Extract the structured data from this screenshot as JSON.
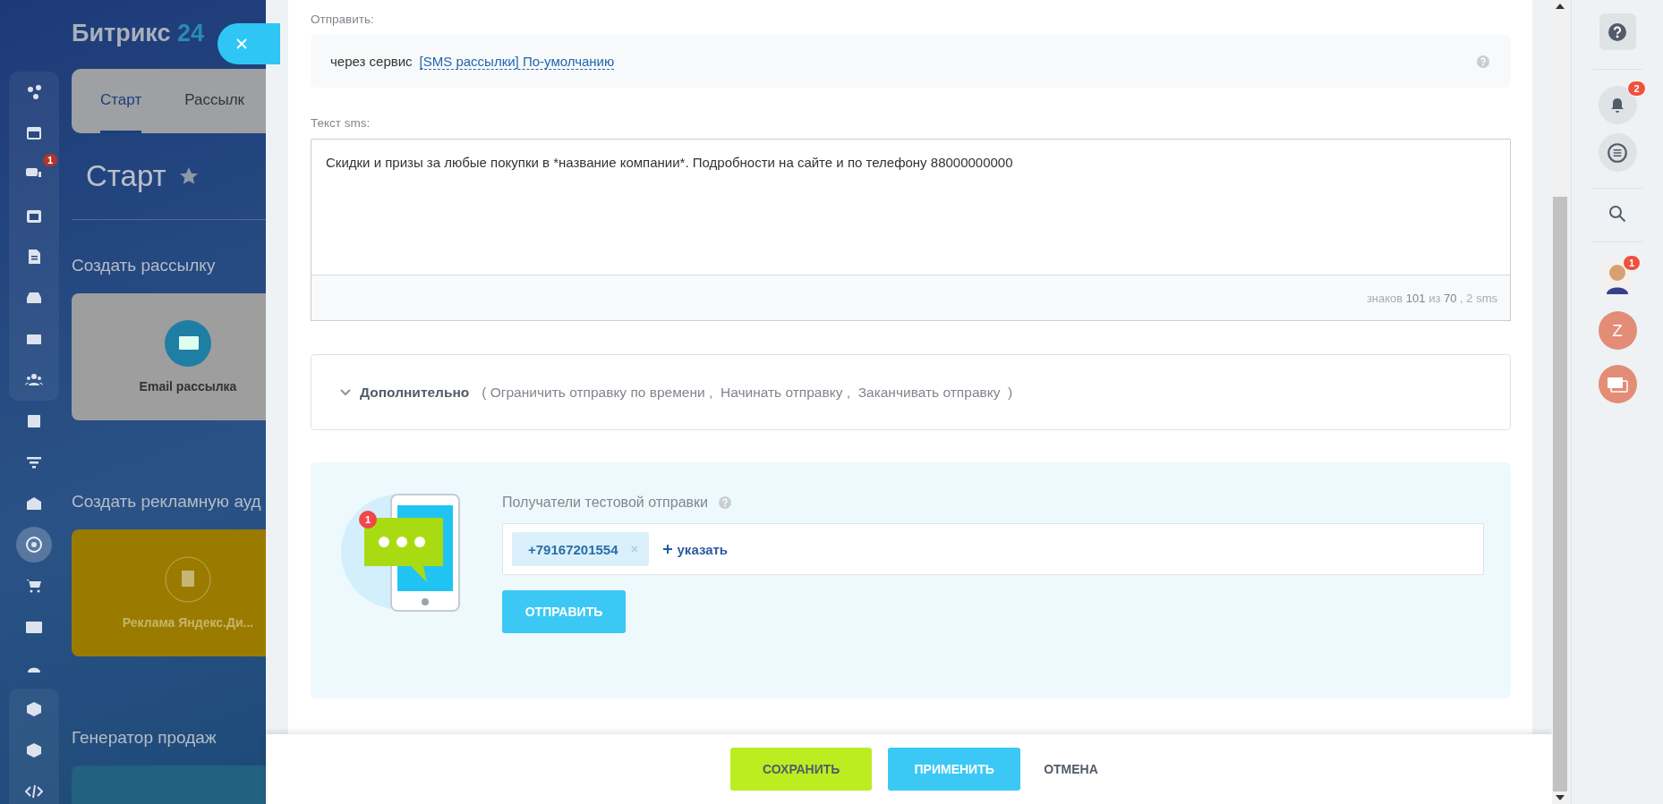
{
  "left_menu": {
    "items": [
      {
        "selected": false
      },
      {
        "selected": false
      },
      {
        "selected": false,
        "badge": "1"
      },
      {
        "selected": false
      },
      {
        "selected": false
      },
      {
        "selected": false
      },
      {
        "selected": false
      },
      {
        "selected": false
      },
      {
        "selected": false
      },
      {
        "selected": false
      },
      {
        "selected": false
      },
      {
        "selected": true
      },
      {
        "selected": false
      },
      {
        "selected": false
      },
      {
        "selected": false
      },
      {
        "selected": false
      },
      {
        "selected": false
      },
      {
        "selected": false
      }
    ]
  },
  "app": {
    "logo": {
      "name": "Битрикс",
      "suffix": "24"
    },
    "tabs": [
      {
        "label": "Старт",
        "selected": true
      },
      {
        "label": "Рассылк",
        "selected": false
      }
    ],
    "heading": "Старт",
    "sections": [
      {
        "title": "Создать рассылку",
        "card": {
          "kind": "email",
          "label": "Email рассылка"
        }
      },
      {
        "title": "Создать рекламную ауд",
        "card": {
          "kind": "ads",
          "label": "Реклама Яндекс.Ди..."
        }
      },
      {
        "title": "Генератор продаж",
        "card": {
          "kind": "sales"
        }
      }
    ]
  },
  "form": {
    "send": {
      "label": "Отправить:",
      "prefix": "через сервис",
      "service_link": "[SMS рассылки] По-умолчанию"
    },
    "sms": {
      "label": "Текст sms:",
      "value": "Скидки и призы за любые покупки в *название компании*. Подробности на сайте и по телефону 88000000000",
      "counter": "знаков **101** из **70** , 2 sms"
    },
    "additional": {
      "title": "Дополнительно",
      "expanded": false,
      "options": "( Ограничить отправку по времени ,  Начинать отправку ,  Заканчивать отправку  )"
    },
    "test": {
      "label": "Получатели тестовой отправки",
      "illustration_badge": "1",
      "recipients": [
        {
          "value": "+79167201554"
        }
      ],
      "add_link": "указать",
      "send_button": "ОТПРАВИТЬ"
    }
  },
  "footer": {
    "buttons": [
      {
        "kind": "save",
        "label": "СОХРАНИТЬ"
      },
      {
        "kind": "apply",
        "label": "ПРИМЕНИТЬ"
      },
      {
        "kind": "cancel",
        "label": "ОТМЕНА"
      }
    ]
  },
  "right_bar": {
    "notifications_badge": "2",
    "avatar_badge": "1",
    "user_letter": "Z"
  }
}
